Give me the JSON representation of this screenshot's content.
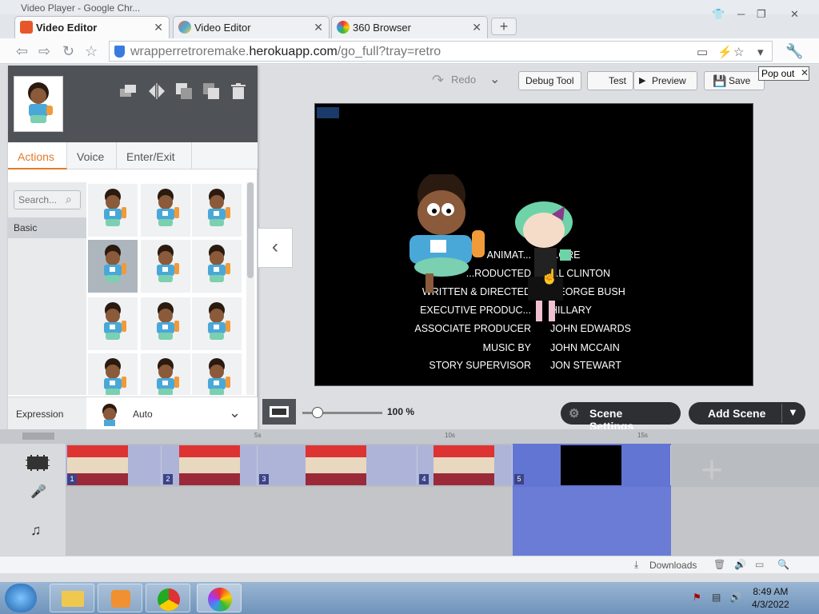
{
  "window_title": "Video Player - Google Chr...",
  "tabs": [
    {
      "label": "Video Editor",
      "active": true
    },
    {
      "label": "Video Editor",
      "active": false
    },
    {
      "label": "360 Browser",
      "active": false
    }
  ],
  "address": {
    "domain_prefix": "wrapperretroremake.",
    "domain": "herokuapp.com",
    "path": "/go_full?tray=retro"
  },
  "toolbar": {
    "redo": "Redo",
    "debug_tool": "Debug Tool",
    "test": "Test",
    "preview": "Preview",
    "save": "Save",
    "pop_out": "Pop out"
  },
  "panel": {
    "tabs": [
      "Actions",
      "Voice",
      "Enter/Exit"
    ],
    "active_tab": "Actions",
    "search_placeholder": "Search...",
    "category": "Basic",
    "expression_label": "Expression",
    "expression_value": "Auto"
  },
  "stage": {
    "credits": [
      {
        "role": "ANIMAT...",
        "name": "...ORE"
      },
      {
        "role": "...RODUCTED",
        "name": "...L CLINTON"
      },
      {
        "role": "WRITTEN & DIRECTED",
        "name": "...EORGE BUSH"
      },
      {
        "role": "EXECUTIVE PRODUC...",
        "name": "HILLARY"
      },
      {
        "role": "ASSOCIATE PRODUCER",
        "name": "JOHN EDWARDS"
      },
      {
        "role": "MUSIC BY",
        "name": "JOHN MCCAIN"
      },
      {
        "role": "STORY SUPERVISOR",
        "name": "JON STEWART"
      }
    ]
  },
  "controls": {
    "zoom": "100 %",
    "scene_settings": "Scene Settings",
    "add_scene": "Add Scene"
  },
  "timeline": {
    "ticks": [
      "5s",
      "10s",
      "15s"
    ],
    "scenes": [
      "1",
      "2",
      "3",
      "4",
      "5"
    ],
    "selected_scene": "5"
  },
  "status": {
    "downloads": "Downloads"
  },
  "clock": {
    "time": "8:49 AM",
    "date": "4/3/2022"
  },
  "colors": {
    "accent_orange": "#e07b2c",
    "selection_blue": "#5468d6",
    "dark_panel": "#4f5257"
  }
}
